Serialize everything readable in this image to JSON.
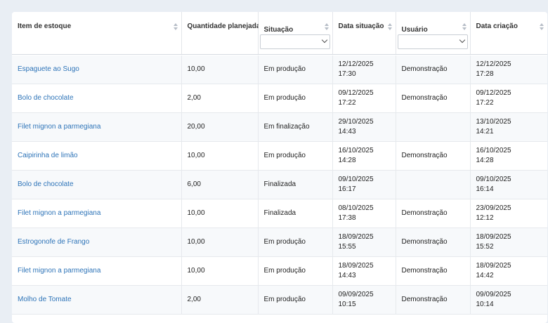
{
  "columns": [
    {
      "label": "Item de estoque"
    },
    {
      "label": "Quantidade planejada"
    },
    {
      "label": "Situação"
    },
    {
      "label": "Data situação"
    },
    {
      "label": "Usuário"
    },
    {
      "label": "Data criação"
    }
  ],
  "rows": [
    {
      "item": "Espaguete ao Sugo",
      "qty": "10,00",
      "status": "Em produção",
      "status_date": "12/12/2025",
      "status_time": "17:30",
      "user": "Demonstração",
      "created_date": "12/12/2025",
      "created_time": "17:28"
    },
    {
      "item": "Bolo de chocolate",
      "qty": "2,00",
      "status": "Em produção",
      "status_date": "09/12/2025",
      "status_time": "17:22",
      "user": "Demonstração",
      "created_date": "09/12/2025",
      "created_time": "17:22"
    },
    {
      "item": "Filet mignon a parmegiana",
      "qty": "20,00",
      "status": "Em finalização",
      "status_date": "29/10/2025",
      "status_time": "14:43",
      "user": "",
      "created_date": "13/10/2025",
      "created_time": "14:21"
    },
    {
      "item": "Caipirinha de limão",
      "qty": "10,00",
      "status": "Em produção",
      "status_date": "16/10/2025",
      "status_time": "14:28",
      "user": "Demonstração",
      "created_date": "16/10/2025",
      "created_time": "14:28"
    },
    {
      "item": "Bolo de chocolate",
      "qty": "6,00",
      "status": "Finalizada",
      "status_date": "09/10/2025",
      "status_time": "16:17",
      "user": "",
      "created_date": "09/10/2025",
      "created_time": "16:14"
    },
    {
      "item": "Filet mignon a parmegiana",
      "qty": "10,00",
      "status": "Finalizada",
      "status_date": "08/10/2025",
      "status_time": "17:38",
      "user": "Demonstração",
      "created_date": "23/09/2025",
      "created_time": "12:12"
    },
    {
      "item": "Estrogonofe de Frango",
      "qty": "10,00",
      "status": "Em produção",
      "status_date": "18/09/2025",
      "status_time": "15:55",
      "user": "Demonstração",
      "created_date": "18/09/2025",
      "created_time": "15:52"
    },
    {
      "item": "Filet mignon a parmegiana",
      "qty": "10,00",
      "status": "Em produção",
      "status_date": "18/09/2025",
      "status_time": "14:43",
      "user": "Demonstração",
      "created_date": "18/09/2025",
      "created_time": "14:42"
    },
    {
      "item": "Molho de Tomate",
      "qty": "2,00",
      "status": "Em produção",
      "status_date": "09/09/2025",
      "status_time": "10:15",
      "user": "Demonstração",
      "created_date": "09/09/2025",
      "created_time": "10:14"
    }
  ]
}
